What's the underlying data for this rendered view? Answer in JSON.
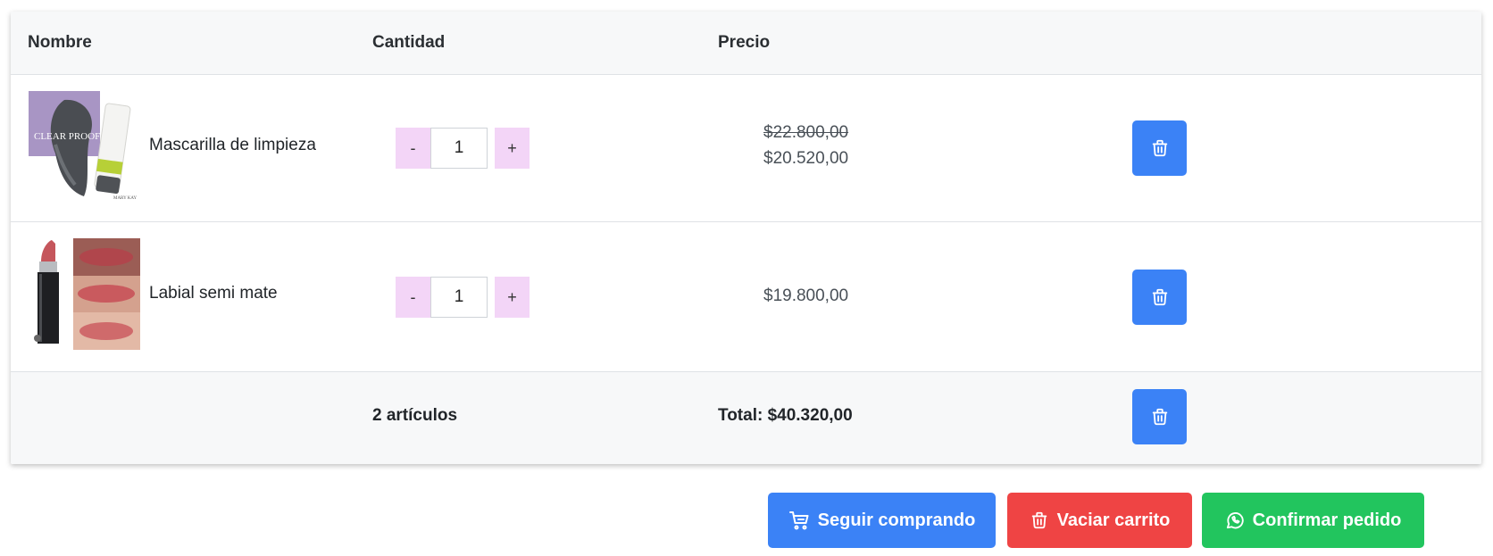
{
  "table": {
    "headers": {
      "name": "Nombre",
      "quantity": "Cantidad",
      "price": "Precio"
    },
    "rows": [
      {
        "image": "product-photo-cleansing-mask",
        "image_caption": "CLEAR PROOF",
        "image_brand": "MARY KAY",
        "name": "Mascarilla de limpieza",
        "quantity": "1",
        "old_price": "$22.800,00",
        "price": "$20.520,00",
        "minus_label": "-",
        "plus_label": "+",
        "remove_icon": "trash-icon"
      },
      {
        "image": "product-photo-lipstick",
        "name": "Labial semi mate",
        "quantity": "1",
        "price": "$19.800,00",
        "minus_label": "-",
        "plus_label": "+",
        "remove_icon": "trash-icon"
      }
    ],
    "footer": {
      "items_count": "2 artículos",
      "total": "Total: $40.320,00",
      "remove_icon": "trash-icon"
    }
  },
  "actions": {
    "continue_shopping": {
      "label": "Seguir comprando",
      "icon": "cart-icon",
      "color": "#3b82f6"
    },
    "empty_cart": {
      "label": "Vaciar carrito",
      "icon": "trash-icon",
      "color": "#ef4444"
    },
    "confirm_order": {
      "label": "Confirmar pedido",
      "icon": "whatsapp-icon",
      "color": "#22c55e"
    }
  },
  "colors": {
    "qty_button_bg": "#f3d5f7",
    "header_bg": "#f7f8f9",
    "primary": "#3b82f6"
  }
}
